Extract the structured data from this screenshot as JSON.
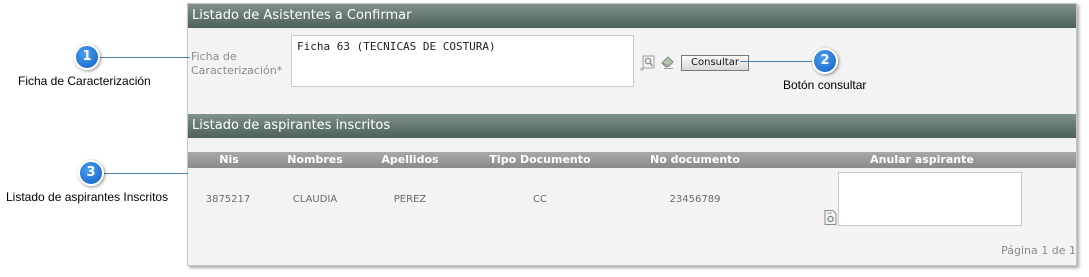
{
  "panel": {
    "section1_title": "Listado de Asistentes a Confirmar",
    "ficha_label": "Ficha de\nCaracterización*",
    "ficha_value": "Ficha 63 (TECNICAS DE COSTURA)",
    "consultar_label": "Consultar",
    "section2_title": "Listado de aspirantes inscritos",
    "table": {
      "headers": [
        "Nis",
        "Nombres",
        "Apellidos",
        "Tipo Documento",
        "No documento",
        "Anular aspirante"
      ],
      "rows": [
        [
          "3875217",
          "CLAUDIA",
          "PEREZ",
          "CC",
          "23456789",
          ""
        ]
      ]
    },
    "pagination": "Página 1 de 1"
  },
  "callouts": [
    {
      "number": "1",
      "text": "Ficha de Caracterización"
    },
    {
      "number": "2",
      "text": "Botón consultar"
    },
    {
      "number": "3",
      "text": "Listado de aspirantes Inscritos"
    }
  ],
  "colors": {
    "header_bg": "#4d6158",
    "table_header_bg": "#8a8a8a",
    "badge_blue": "#1a6fd0",
    "callout_line": "#4a7fb8"
  },
  "icons": [
    "magnifier-icon",
    "eraser-icon",
    "document-icon"
  ]
}
